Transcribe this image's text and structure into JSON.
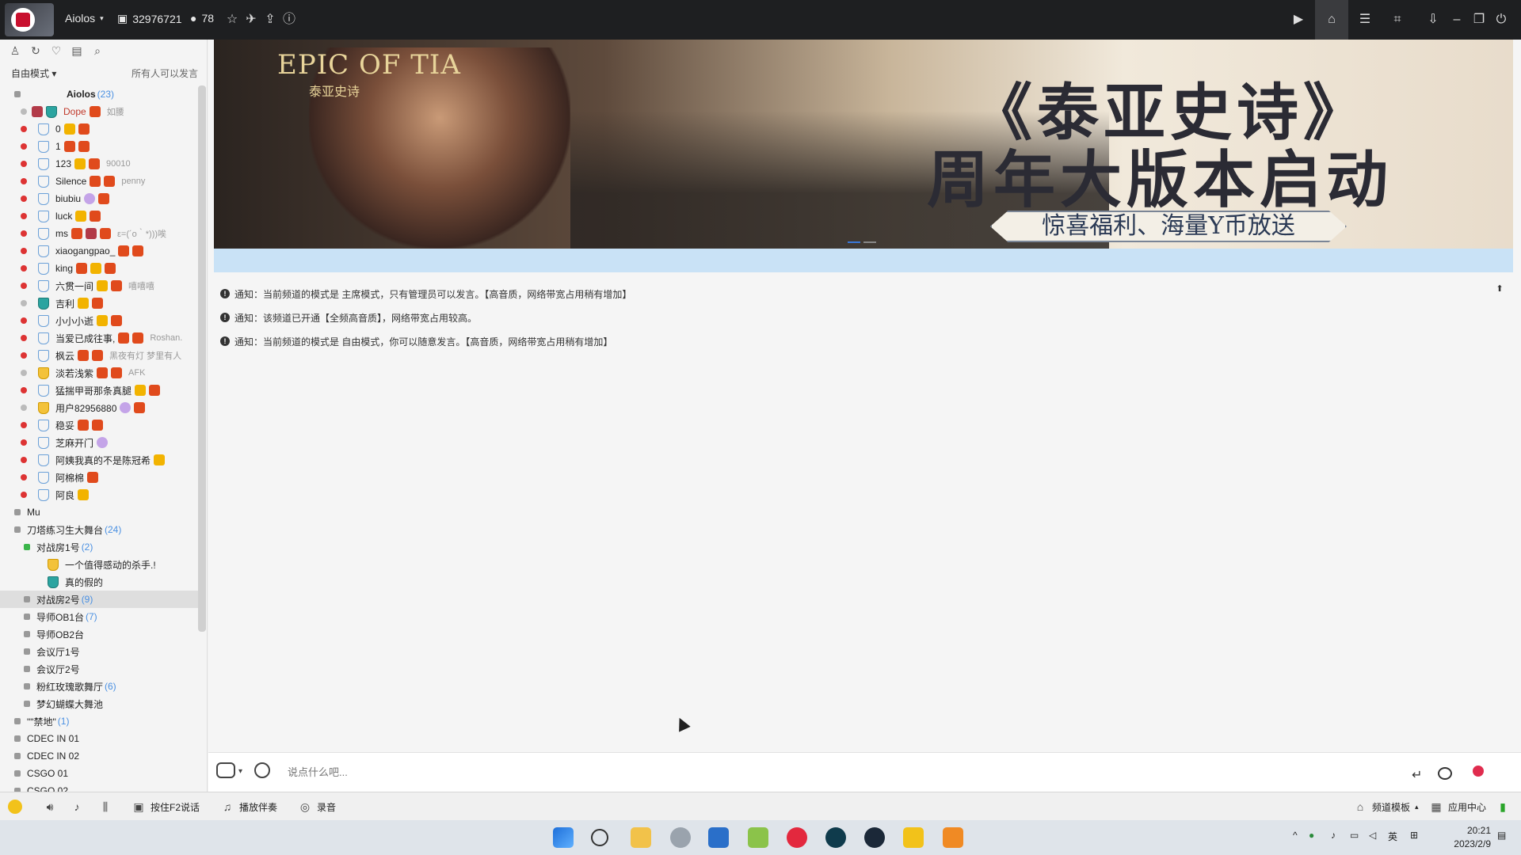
{
  "titlebar": {
    "app_name": "Aiolos",
    "channel_id_label": "32976721",
    "online_count": "78"
  },
  "sidebar": {
    "mode_label": "自由模式",
    "permission_label": "所有人可以发言",
    "root_channel": {
      "name": "Aiolos",
      "count": "(23)"
    },
    "owner": {
      "name": "Dope",
      "sig": "如腰"
    },
    "members": [
      {
        "name": "0",
        "sig": ""
      },
      {
        "name": "1",
        "sig": ""
      },
      {
        "name": "123",
        "sig": "90010"
      },
      {
        "name": "Silence",
        "sig": "penny"
      },
      {
        "name": "biubiu",
        "sig": ""
      },
      {
        "name": "luck",
        "sig": ""
      },
      {
        "name": "ms",
        "sig": "ε=(´ο｀*)))唉"
      },
      {
        "name": "xiaogangpao_",
        "sig": ""
      },
      {
        "name": "king",
        "sig": ""
      },
      {
        "name": "六贯一间",
        "sig": "嘻嘻嘻"
      },
      {
        "name": "吉利",
        "sig": ""
      },
      {
        "name": "小小小逝",
        "sig": ""
      },
      {
        "name": "当爱已成往事,",
        "sig": "Roshan."
      },
      {
        "name": "枫云",
        "sig": "黑夜有灯 梦里有人"
      },
      {
        "name": "淡若浅紫",
        "sig": "AFK"
      },
      {
        "name": "猛揣甲哥那条真腿",
        "sig": ""
      },
      {
        "name": "用户82956880",
        "sig": ""
      },
      {
        "name": "稳妥",
        "sig": ""
      },
      {
        "name": "芝麻开门",
        "sig": ""
      },
      {
        "name": "阿姨我真的不是陈冠希",
        "sig": ""
      },
      {
        "name": "阿棉棉",
        "sig": ""
      },
      {
        "name": "阿良",
        "sig": ""
      }
    ],
    "channels": [
      {
        "name": "Mu",
        "count": ""
      },
      {
        "name": "刀塔练习生大舞台",
        "count": "(24)"
      },
      {
        "name": "对战房1号",
        "count": "(2)"
      },
      {
        "name": "一个值得感动的杀手.!",
        "count": ""
      },
      {
        "name": "真的假的",
        "count": ""
      },
      {
        "name": "对战房2号",
        "count": "(9)"
      },
      {
        "name": "导师OB1台",
        "count": "(7)"
      },
      {
        "name": "导师OB2台",
        "count": ""
      },
      {
        "name": "会议厅1号",
        "count": ""
      },
      {
        "name": "会议厅2号",
        "count": ""
      },
      {
        "name": "粉红玫瑰歌舞厅",
        "count": "(6)"
      },
      {
        "name": "梦幻蝴蝶大舞池",
        "count": ""
      },
      {
        "name": "\"\"禁地\"",
        "count": "(1)"
      },
      {
        "name": "CDEC IN 01",
        "count": ""
      },
      {
        "name": "CDEC IN 02",
        "count": ""
      },
      {
        "name": "CSGO 01",
        "count": ""
      },
      {
        "name": "CSGO 02",
        "count": ""
      }
    ]
  },
  "banner": {
    "logo": "EPIC OF TIA",
    "logo_sub": "泰亚史诗",
    "title_line1": "《泰亚史诗》",
    "title_line2": "周年大版本启动",
    "subtitle": "惊喜福利、海量Y币放送"
  },
  "notices": [
    {
      "label": "通知：",
      "text": "当前频道的模式是 主席模式，只有管理员可以发言。【高音质，网络带宽占用稍有增加】"
    },
    {
      "label": "通知：",
      "text": "该频道已开通【全频高音质】，网络带宽占用较高。"
    },
    {
      "label": "通知：",
      "text": "当前频道的模式是 自由模式，你可以随意发言。【高音质，网络带宽占用稍有增加】"
    }
  ],
  "input": {
    "placeholder": "说点什么吧..."
  },
  "bottombar": {
    "push_to_talk": "按住F2说话",
    "play_music": "播放伴奏",
    "record": "录音",
    "channel_template": "频道模板",
    "app_center": "应用中心"
  },
  "taskbar": {
    "time": "20:21",
    "date": "2023/2/9",
    "ime": "英"
  }
}
